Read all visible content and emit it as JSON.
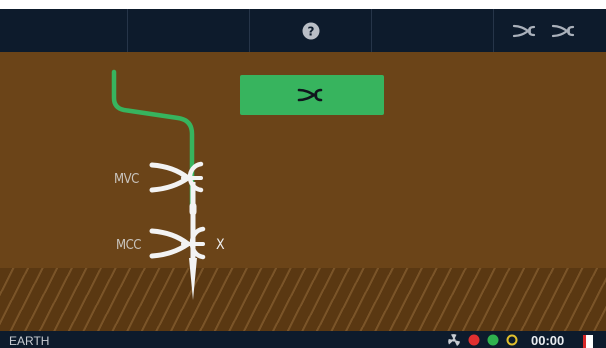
{
  "toolbar": {
    "segments": [
      "",
      "",
      "help-icon",
      "",
      "instrument-pair-icon"
    ]
  },
  "scene": {
    "label_upper": "MVC",
    "label_lower": "MCC",
    "marker_lower": "X",
    "wire_color": "#37b45e",
    "field_color": "#6b4418"
  },
  "status": {
    "text": "EARTH",
    "timer": "00:00",
    "indicators": [
      {
        "name": "fan-icon",
        "color": "#c8ccd2"
      },
      {
        "name": "red-dot",
        "color": "#e03030"
      },
      {
        "name": "green-dot",
        "color": "#2fb24e"
      },
      {
        "name": "yellow-ring",
        "color": "#e1c02c"
      }
    ]
  }
}
